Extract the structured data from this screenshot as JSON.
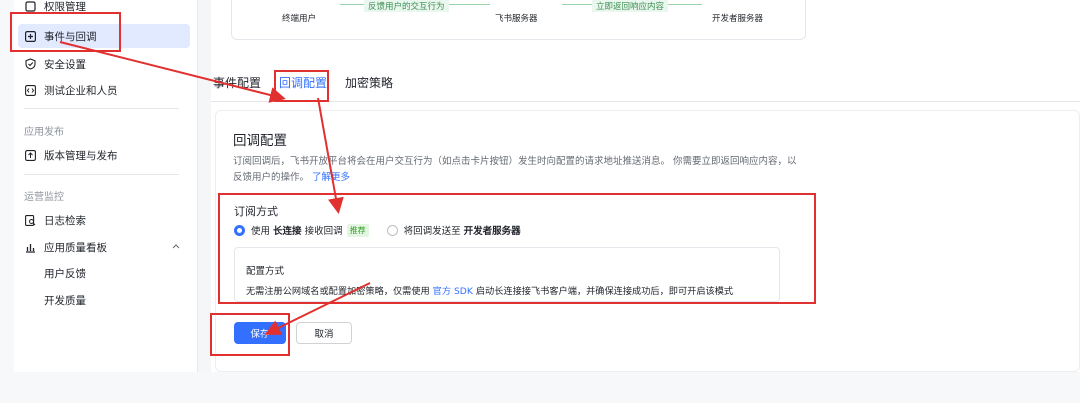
{
  "sidebar": {
    "top_partial": "权限管理",
    "items": [
      {
        "label": "事件与回调",
        "icon": "square-plus-icon",
        "active": true
      },
      {
        "label": "安全设置",
        "icon": "shield-check-icon"
      },
      {
        "label": "测试企业和人员",
        "icon": "code-box-icon"
      }
    ],
    "group_publish": "应用发布",
    "publish_items": [
      {
        "label": "版本管理与发布",
        "icon": "upload-box-icon"
      }
    ],
    "group_ops": "运营监控",
    "ops_items": [
      {
        "label": "日志检索",
        "icon": "doc-search-icon"
      },
      {
        "label": "应用质量看板",
        "icon": "bar-chart-icon"
      }
    ],
    "ops_sub": [
      "用户反馈",
      "开发质量"
    ]
  },
  "flow": {
    "node_user": "终端用户",
    "label_feedback": "反馈用户的交互行为",
    "node_feishu": "飞书服务器",
    "label_return": "立即返回响应内容",
    "node_dev": "开发者服务器"
  },
  "tabs": [
    "事件配置",
    "回调配置",
    "加密策略"
  ],
  "panel": {
    "title": "回调配置",
    "desc": "订阅回调后，飞书开放平台将会在用户交互行为（如点击卡片按钮）发生时向配置的请求地址推送消息。 你需要立即返回响应内容，以反馈用户的操作。",
    "learn_more": "了解更多",
    "sub_title": "订阅方式",
    "option1_pre": "使用",
    "option1_bold": "长连接",
    "option1_post": "接收回调",
    "option1_tag": "推荐",
    "option2_pre": "将回调发送至",
    "option2_bold": "开发者服务器",
    "mode_title": "配置方式",
    "mode_text_pre": "无需注册公网域名或配置加密策略，仅需使用",
    "mode_link": "官方 SDK",
    "mode_text_post": "启动长连接接飞书客户端，并确保连接成功后，即可开启该模式"
  },
  "buttons": {
    "save": "保存",
    "cancel": "取消"
  },
  "colors": {
    "accent": "#3370ff",
    "annotation": "#e03030",
    "active_bg": "#e1eaff"
  }
}
